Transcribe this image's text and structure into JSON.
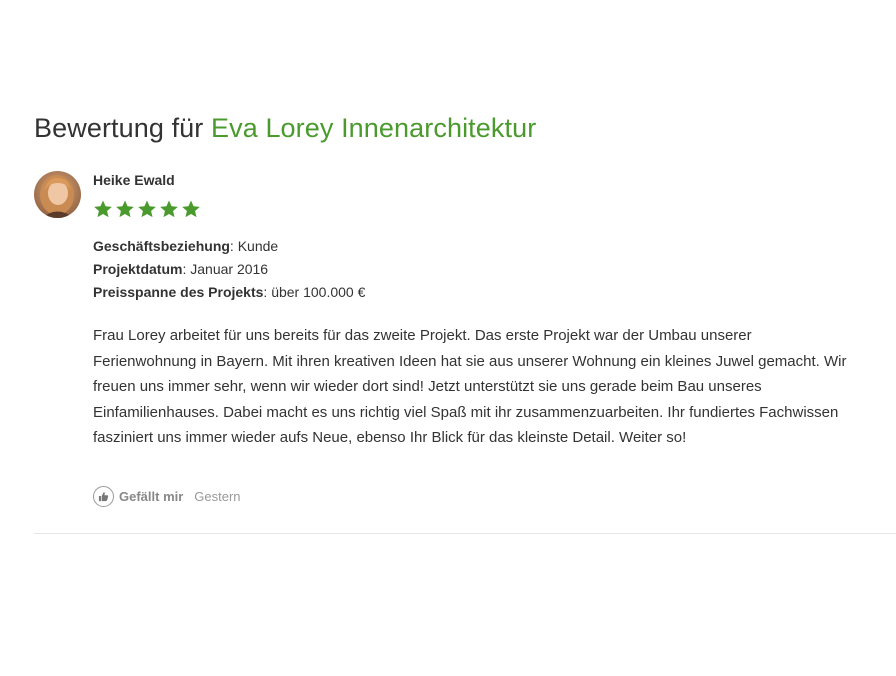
{
  "heading": {
    "prefix": "Bewertung für",
    "company": "Eva Lorey Innenarchitektur"
  },
  "review": {
    "reviewer_name": "Heike Ewald",
    "rating": 5,
    "rating_max": 5,
    "star_color": "#4a9a2e",
    "meta": [
      {
        "label": "Geschäftsbeziehung",
        "value": ": Kunde"
      },
      {
        "label": "Projektdatum",
        "value": ": Januar 2016"
      },
      {
        "label": "Preisspanne des Projekts",
        "value": ": über 100.000 €"
      }
    ],
    "body": "Frau Lorey arbeitet für uns bereits für das zweite Projekt. Das erste Projekt war der Umbau unserer Ferienwohnung in Bayern. Mit ihren kreativen Ideen hat sie aus unserer Wohnung ein kleines Juwel gemacht. Wir freuen uns immer sehr, wenn wir wieder dort sind! Jetzt unterstützt sie uns gerade beim Bau unseres Einfamilienhauses. Dabei macht es uns richtig viel Spaß mit ihr zusammenzuarbeiten. Ihr fundiertes Fachwissen fasziniert uns immer wieder aufs Neue, ebenso Ihr Blick für das kleinste Detail. Weiter so!",
    "like_label": "Gefällt mir",
    "timestamp": "Gestern"
  },
  "icons": {
    "avatar": "reviewer-avatar",
    "star": "star-icon",
    "like": "thumbs-up-icon"
  },
  "colors": {
    "accent": "#4a9a2e",
    "text": "#333333",
    "muted": "#888888"
  }
}
